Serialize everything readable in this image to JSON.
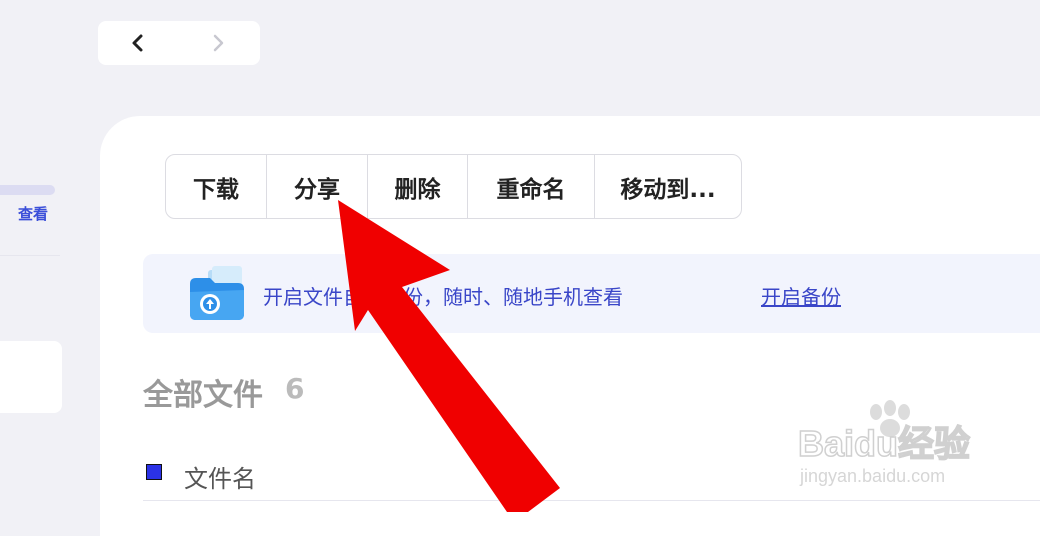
{
  "nav": {
    "back_icon": "chevron-left-icon",
    "forward_icon": "chevron-right-icon"
  },
  "sidebar": {
    "view_label": "查看"
  },
  "toolbar": {
    "download_label": "下载",
    "share_label": "分享",
    "delete_label": "删除",
    "rename_label": "重命名",
    "move_label": "移动到..."
  },
  "banner": {
    "icon": "backup-folder-icon",
    "text": "开启文件自动备份，随时、随地手机查看",
    "link": "开启备份"
  },
  "section": {
    "title": "全部文件",
    "count": "6"
  },
  "file_list": {
    "column_name": "文件名"
  },
  "watermark": {
    "brand": "Baidu经验",
    "url": "jingyan.baidu.com"
  },
  "annotation": {
    "icon": "red-arrow-icon",
    "color": "#f00000"
  }
}
